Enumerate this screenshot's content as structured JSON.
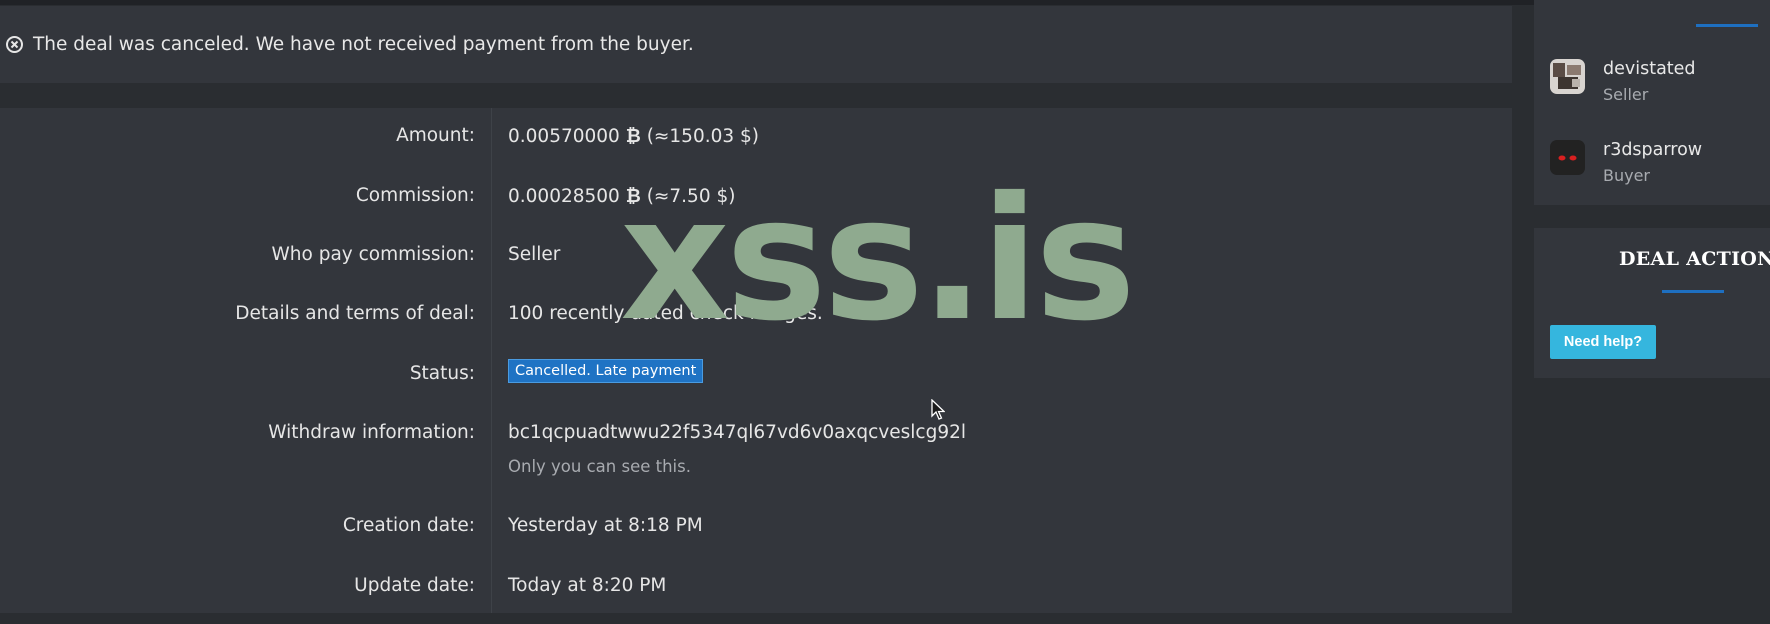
{
  "notice": {
    "icon": "circle-x-icon",
    "text": "The deal was canceled. We have not received payment from the buyer."
  },
  "details": {
    "amount": {
      "label": "Amount:",
      "value": "0.00570000",
      "btc": "₿",
      "usd": "(≈150.03 $)"
    },
    "commission": {
      "label": "Commission:",
      "value": "0.00028500",
      "btc": "₿",
      "usd": "(≈7.50 $)"
    },
    "who_pays": {
      "label": "Who pay commission:",
      "value": "Seller"
    },
    "terms": {
      "label": "Details and terms of deal:",
      "value": "100 recently dated check images."
    },
    "status": {
      "label": "Status:",
      "value": "Cancelled. Late payment",
      "color": "#1f73c4"
    },
    "withdraw": {
      "label": "Withdraw information:",
      "value": "bc1qcpuadtwwu22f5347ql67vd6v0axqcveslcg92l",
      "note": "Only you can see this."
    },
    "created": {
      "label": "Creation date:",
      "value": "Yesterday at 8:18 PM"
    },
    "updated": {
      "label": "Update date:",
      "value": "Today at 8:20 PM"
    }
  },
  "watermark": "xss.is",
  "participants": [
    {
      "name": "devistated",
      "role": "Seller"
    },
    {
      "name": "r3dsparrow",
      "role": "Buyer"
    }
  ],
  "deal_actions": {
    "title": "DEAL ACTIONS",
    "help_label": "Need help?",
    "accent_color": "#1e6fc0",
    "button_color": "#35b6de"
  }
}
